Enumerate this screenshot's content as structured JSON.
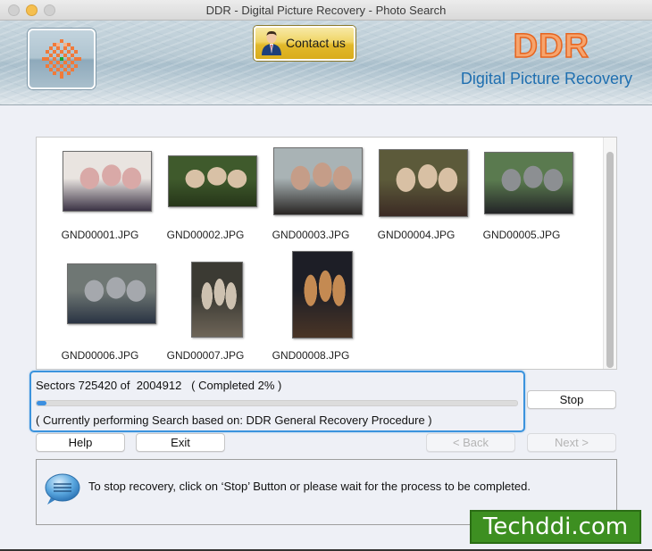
{
  "window": {
    "title": "DDR - Digital Picture Recovery - Photo Search"
  },
  "header": {
    "logo_icon": "ddr-logo-icon",
    "contact_button": "Contact us",
    "brand": "DDR",
    "product_name": "Digital Picture Recovery"
  },
  "results": {
    "files": [
      {
        "name": "GND00001.JPG",
        "thumb_colors": [
          "#e9e4e0",
          "#d9a9a7",
          "#3b3345"
        ]
      },
      {
        "name": "GND00002.JPG",
        "thumb_colors": [
          "#3f5a2c",
          "#d8c1a6",
          "#263619"
        ]
      },
      {
        "name": "GND00003.JPG",
        "thumb_colors": [
          "#a9b3b5",
          "#c59d88",
          "#282523"
        ]
      },
      {
        "name": "GND00004.JPG",
        "thumb_colors": [
          "#5c5a3a",
          "#d8c0a4",
          "#3b2a24"
        ]
      },
      {
        "name": "GND00005.JPG",
        "thumb_colors": [
          "#5a7a4f",
          "#8c8f92",
          "#232427"
        ]
      },
      {
        "name": "GND00006.JPG",
        "thumb_colors": [
          "#6f7774",
          "#a5a8ad",
          "#2a3443"
        ]
      },
      {
        "name": "GND00007.JPG",
        "thumb_colors": [
          "#3b3a33",
          "#cdc1b0",
          "#6e6558"
        ]
      },
      {
        "name": "GND00008.JPG",
        "thumb_colors": [
          "#1d1e26",
          "#c48a52",
          "#4a3526"
        ]
      }
    ]
  },
  "progress": {
    "sectors_text": "Sectors 725420 of  2004912   ( Completed 2% )",
    "sectors_done": 725420,
    "sectors_total": 2004912,
    "percent_complete": 2,
    "procedure_text": "( Currently performing Search based on: DDR General Recovery Procedure )",
    "accent_color": "#3b8fe0"
  },
  "buttons": {
    "stop": "Stop",
    "help": "Help",
    "exit": "Exit",
    "back": "< Back",
    "next": "Next >"
  },
  "info": {
    "icon": "speech-bubble-icon",
    "message": "To stop recovery, click on ‘Stop’ Button or please wait for the process to be completed."
  },
  "watermark": {
    "text": "Techddi.com",
    "color": "#3d8f21"
  }
}
